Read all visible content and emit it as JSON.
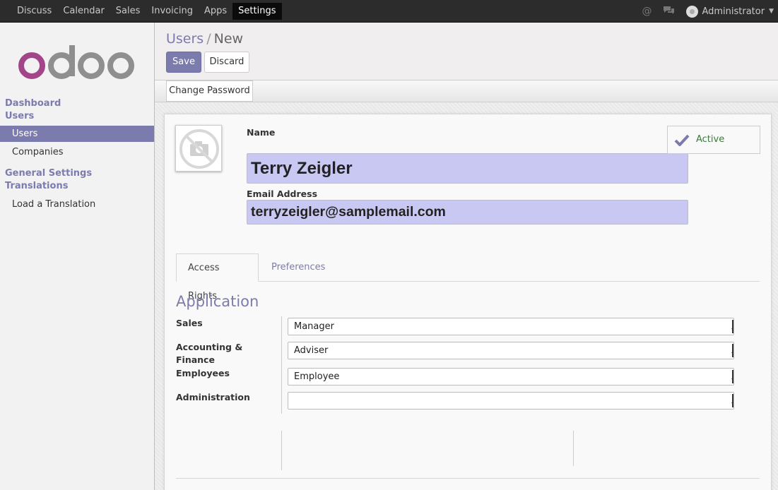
{
  "topbar": {
    "menu": [
      "Discuss",
      "Calendar",
      "Sales",
      "Invoicing",
      "Apps",
      "Settings"
    ],
    "user_name": "Administrator",
    "icons": [
      "at-icon",
      "chat-icon"
    ]
  },
  "sidebar": {
    "logo_text": "odoo",
    "sections": [
      {
        "label": "Dashboard"
      },
      {
        "label": "Users",
        "items": [
          "Users",
          "Companies"
        ]
      },
      {
        "label": "General Settings"
      },
      {
        "label": "Translations",
        "items": [
          "Load a Translation"
        ]
      }
    ],
    "active_item": "Users"
  },
  "control_panel": {
    "breadcrumb_parent": "Users",
    "breadcrumb_sep": "/",
    "breadcrumb_current": "New",
    "save_label": "Save",
    "discard_label": "Discard"
  },
  "statusbar": {
    "change_password_label": "Change Password"
  },
  "form": {
    "name_label": "Name",
    "name_value": "Terry Zeigler",
    "email_label": "Email Address",
    "email_value": "terryzeigler@samplemail.com",
    "active_label": "Active",
    "tabs": [
      "Access Rights",
      "Preferences"
    ],
    "section_title": "Application",
    "rights": [
      {
        "label": "Sales",
        "value": "Manager"
      },
      {
        "label": "Accounting & Finance",
        "value": "Adviser"
      },
      {
        "label": "Employees",
        "value": "Employee"
      },
      {
        "label": "Administration",
        "value": ""
      }
    ]
  },
  "colors": {
    "brand": "#7c7bad",
    "topbar": "#2c2c2c",
    "required_field": "#c9c8f3",
    "logo_o": "#a24689",
    "logo_grey": "#8f8f8f"
  }
}
